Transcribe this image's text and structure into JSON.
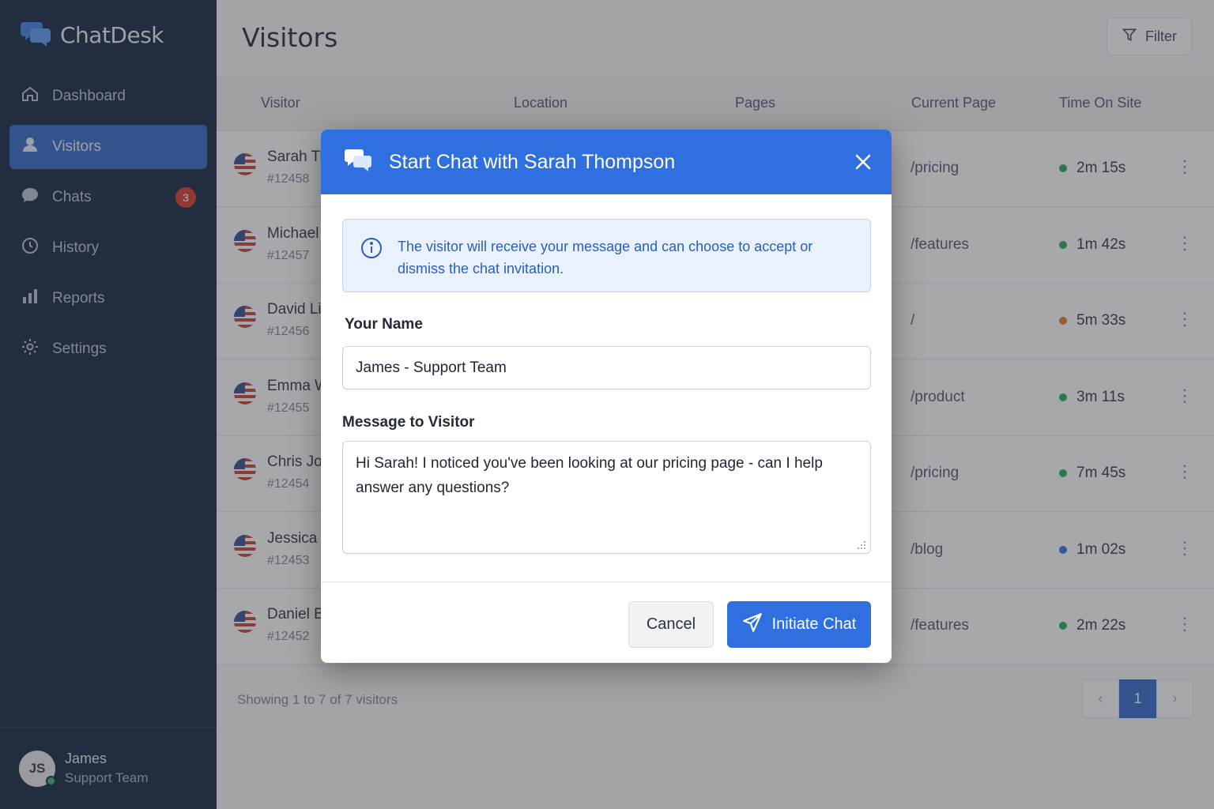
{
  "app": {
    "name": "ChatDesk"
  },
  "sidebar": {
    "items": [
      {
        "label": "Dashboard",
        "icon": "home-icon"
      },
      {
        "label": "Visitors",
        "icon": "user-icon",
        "active": true
      },
      {
        "label": "Chats",
        "icon": "chat-icon",
        "badge": "3"
      },
      {
        "label": "History",
        "icon": "clock-icon"
      },
      {
        "label": "Reports",
        "icon": "bar-chart-icon"
      },
      {
        "label": "Settings",
        "icon": "gear-icon"
      }
    ],
    "user": {
      "initials": "JS",
      "name": "James",
      "role": "Support Team",
      "status_color": "#2fb36a"
    }
  },
  "main": {
    "title": "Visitors",
    "filter_label": "Filter",
    "columns": [
      "Visitor",
      "Location",
      "Pages",
      "Current Page",
      "Time On Site"
    ],
    "rows": [
      {
        "name": "Sarah Ti",
        "id": "#12458",
        "current_page": "/pricing",
        "time": "2m 15s",
        "status_color": "#22a55a"
      },
      {
        "name": "Michael",
        "id": "#12457",
        "current_page": "/features",
        "time": "1m 42s",
        "status_color": "#22a55a"
      },
      {
        "name": "David Li",
        "id": "#12456",
        "current_page": "/",
        "time": "5m 33s",
        "status_color": "#e07b1a"
      },
      {
        "name": "Emma W",
        "id": "#12455",
        "current_page": "/product",
        "time": "3m 11s",
        "status_color": "#22a55a"
      },
      {
        "name": "Chris Jo",
        "id": "#12454",
        "current_page": "/pricing",
        "time": "7m 45s",
        "status_color": "#22a55a"
      },
      {
        "name": "Jessica",
        "id": "#12453",
        "current_page": "/blog",
        "time": "1m 02s",
        "status_color": "#2f6fe0"
      },
      {
        "name": "Daniel B",
        "id": "#12452",
        "current_page": "/features",
        "time": "2m 22s",
        "status_color": "#22a55a"
      }
    ],
    "showing_text": "Showing 1 to 7 of 7 visitors",
    "pagination": {
      "prev": "‹",
      "current": "1",
      "next": "›"
    }
  },
  "modal": {
    "title": "Start Chat with Sarah Thompson",
    "info_text": "The visitor will receive your message and can choose to accept or dismiss the chat invitation.",
    "name_label": "Your Name",
    "name_value": "James - Support Team",
    "message_label": "Message to Visitor",
    "message_value": "Hi Sarah! I noticed you've been looking at our pricing page - can I help answer any questions?",
    "cancel_label": "Cancel",
    "submit_label": "Initiate Chat",
    "accent_color": "#2f6fe0"
  }
}
